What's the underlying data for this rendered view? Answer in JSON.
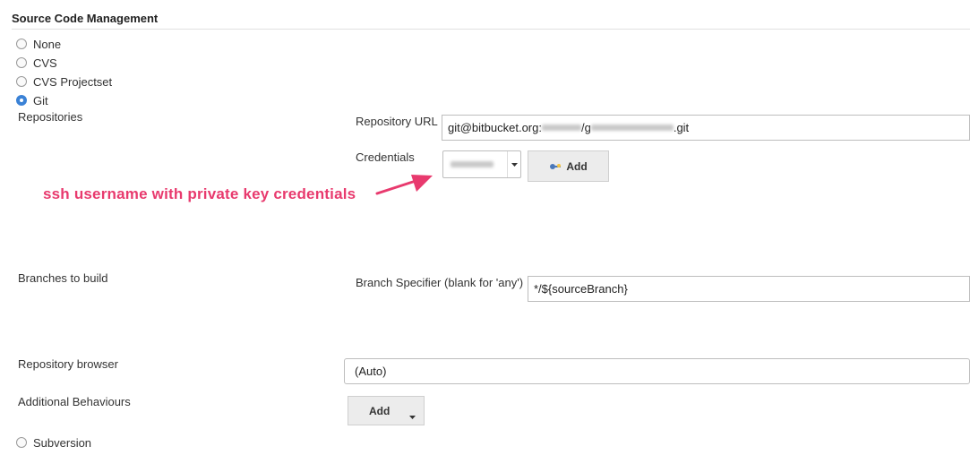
{
  "section": {
    "title": "Source Code Management"
  },
  "scm_options": [
    {
      "label": "None",
      "selected": false
    },
    {
      "label": "CVS",
      "selected": false
    },
    {
      "label": "CVS Projectset",
      "selected": false
    },
    {
      "label": "Git",
      "selected": true
    }
  ],
  "git": {
    "repositories_label": "Repositories",
    "repo_url_label": "Repository URL",
    "repo_url_prefix": "git@bitbucket.org:",
    "repo_url_mid": "/g",
    "repo_url_suffix": ".git",
    "credentials_label": "Credentials",
    "credentials_add": "Add",
    "branches_label": "Branches to build",
    "branch_spec_label": "Branch Specifier (blank for 'any')",
    "branch_spec_value": "*/${sourceBranch}",
    "repo_browser_label": "Repository browser",
    "repo_browser_value": "(Auto)",
    "additional_label": "Additional Behaviours",
    "additional_add": "Add"
  },
  "subversion": {
    "label": "Subversion",
    "selected": false
  },
  "annotation": {
    "text": "ssh username with private key credentials",
    "color": "#e83a6e"
  },
  "colors": {
    "accent": "#3b82d6",
    "annotation": "#e83a6e"
  },
  "icons": {
    "radio": "radio-button",
    "key": "key-icon",
    "caret": "caret-down-icon",
    "arrow": "arrow-icon"
  }
}
